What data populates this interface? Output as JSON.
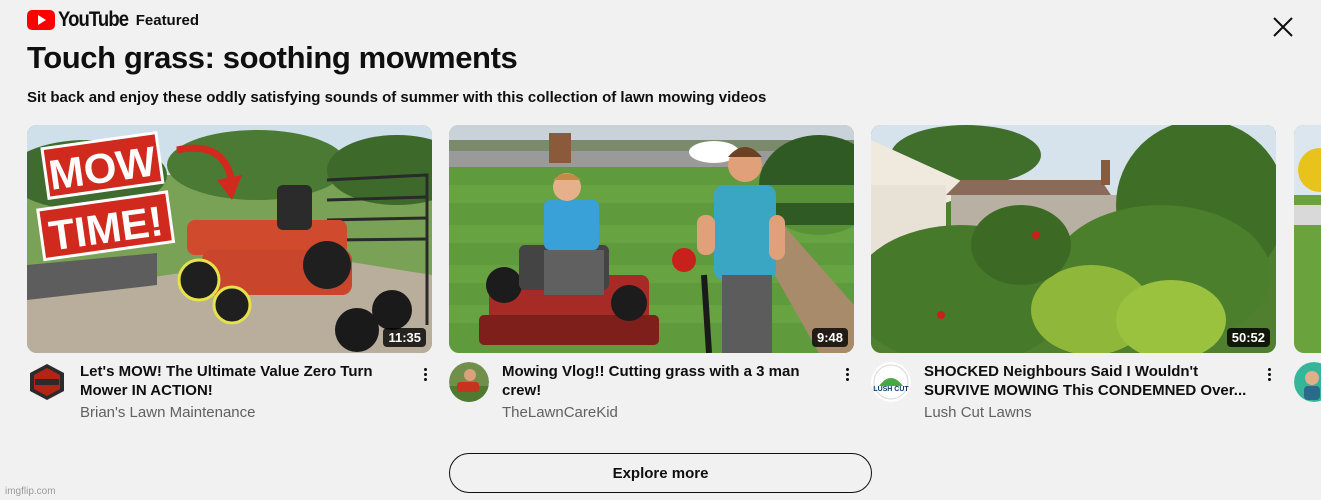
{
  "header": {
    "logo_text": "YouTube",
    "label": "Featured"
  },
  "playlist": {
    "title": "Touch grass: soothing mowments",
    "description": "Sit back and enjoy these oddly satisfying sounds of summer with this collection of lawn mowing videos"
  },
  "videos": [
    {
      "title": "Let's MOW! The Ultimate Value Zero Turn Mower IN ACTION!",
      "channel": "Brian's Lawn Maintenance",
      "duration": "11:35",
      "thumb_text": [
        "MOW",
        "TIME!"
      ]
    },
    {
      "title": "Mowing Vlog!! Cutting grass with a 3 man crew!",
      "channel": "TheLawnCareKid",
      "duration": "9:48"
    },
    {
      "title": "SHOCKED Neighbours Said I Wouldn't SURVIVE MOWING This CONDEMNED Over...",
      "channel": "Lush Cut Lawns",
      "duration": "50:52",
      "avatar_text": "LUSH CUT"
    }
  ],
  "explore_label": "Explore more",
  "watermark": "imgflip.com",
  "colors": {
    "brand_red": "#ff0000",
    "background": "#f1f1f1",
    "text_primary": "#0f0f0f",
    "text_secondary": "#606060"
  },
  "icons": {
    "close": "close-icon",
    "more": "more-vert-icon",
    "logo": "youtube-play-icon"
  }
}
